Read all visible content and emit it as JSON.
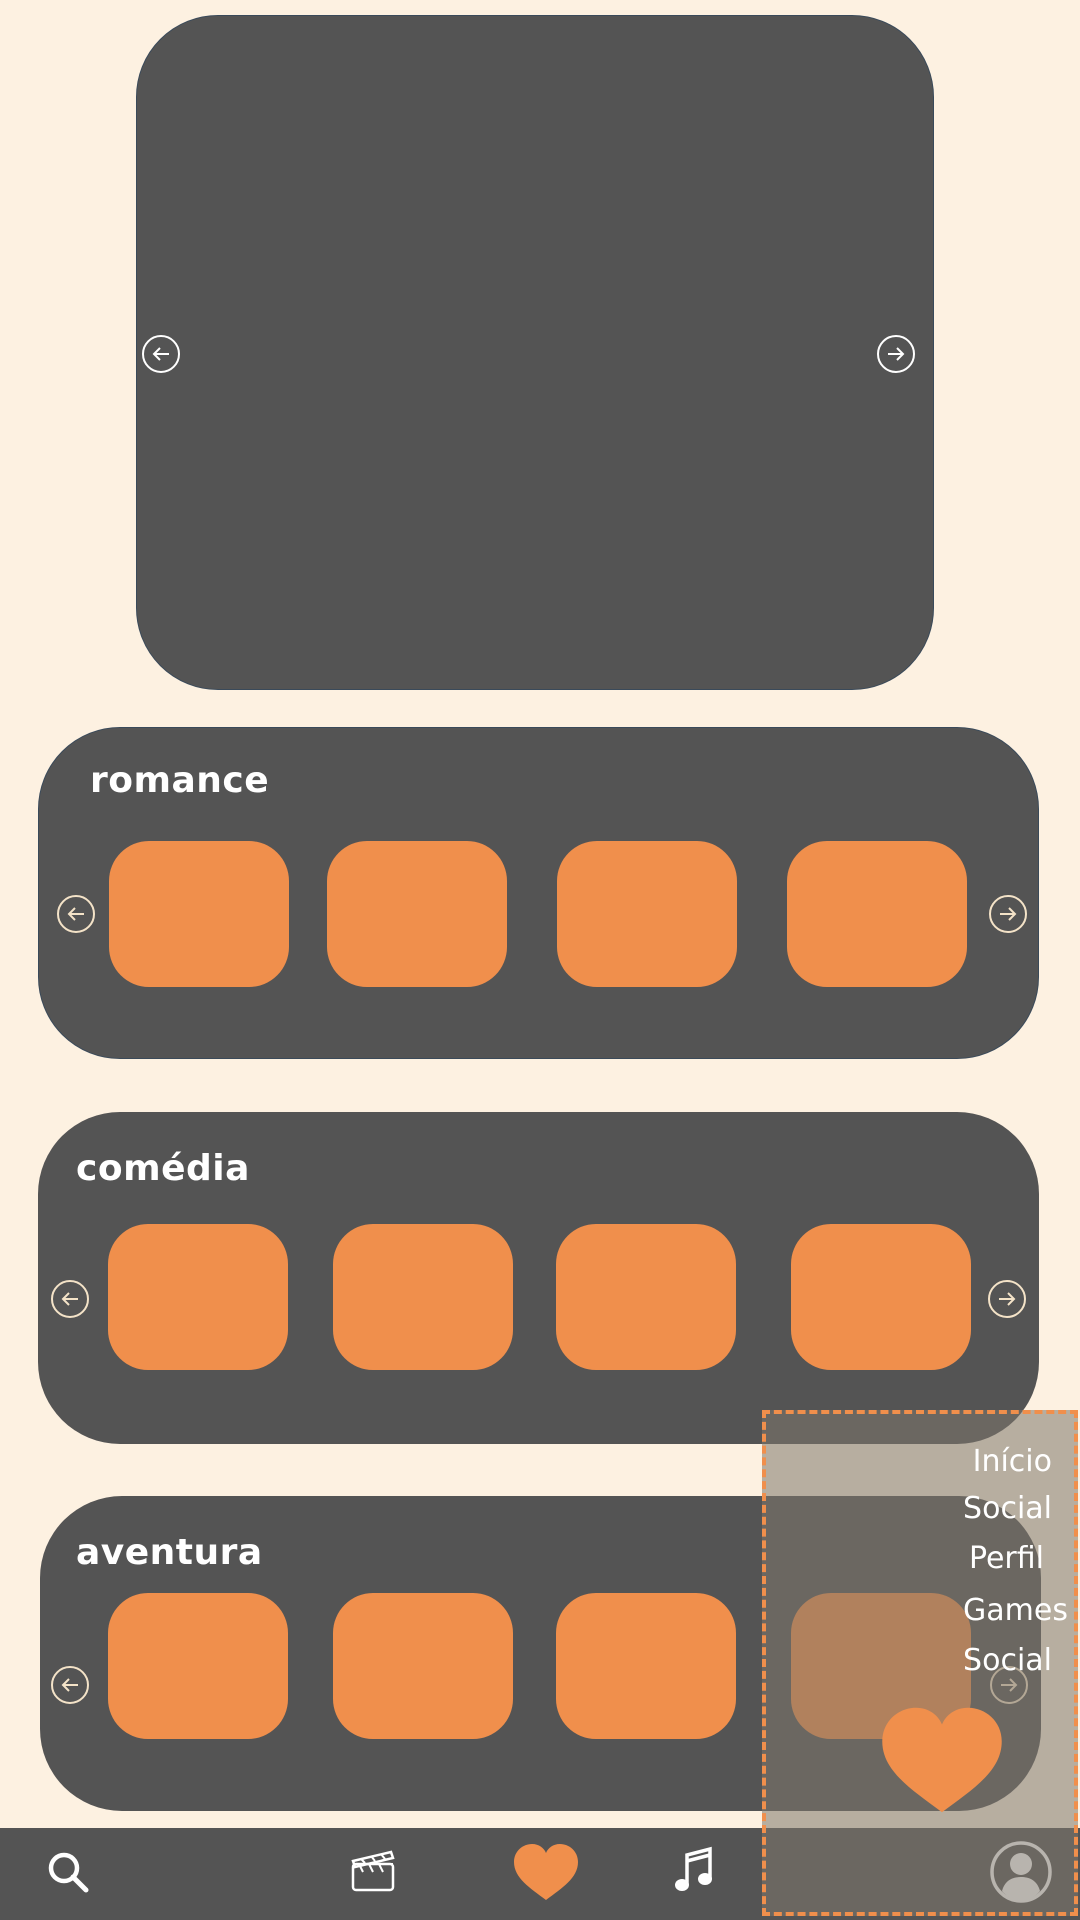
{
  "hero": {
    "prev_icon": "arrow-left-circle-icon",
    "next_icon": "arrow-right-circle-icon"
  },
  "rows": [
    {
      "title": "romance",
      "cards": 4
    },
    {
      "title": "comédia",
      "cards": 4
    },
    {
      "title": "aventura",
      "cards": 4
    }
  ],
  "menu": {
    "items": [
      "Início",
      "Social",
      "Perfil",
      "Games",
      "Social"
    ],
    "icon": "heart-icon"
  },
  "navbar": {
    "icons": [
      "search-icon",
      "clapperboard-icon",
      "heart-icon",
      "music-note-icon",
      "user-profile-icon"
    ]
  },
  "colors": {
    "background": "#FDF1E1",
    "panel": "#545454",
    "accent": "#F08F4C",
    "arrow_outline": "#F4E3C8"
  }
}
